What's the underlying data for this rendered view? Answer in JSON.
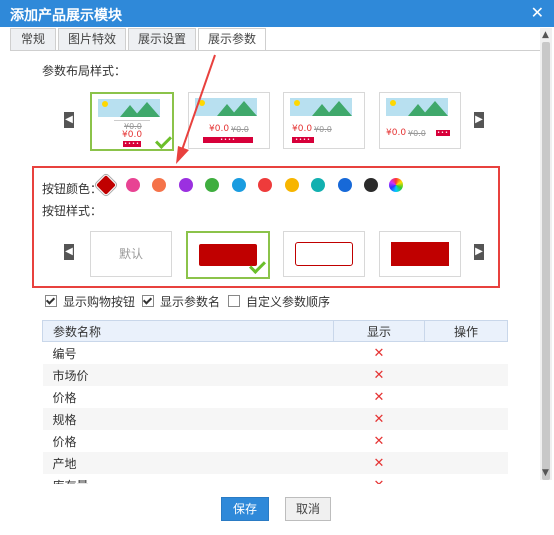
{
  "dialog": {
    "title": "添加产品展示模块",
    "close_glyph": "✕"
  },
  "tabs": [
    {
      "label": "常规"
    },
    {
      "label": "图片特效"
    },
    {
      "label": "展示设置"
    },
    {
      "label": "展示参数"
    }
  ],
  "layout_section": {
    "label": "参数布局样式：",
    "cards": [
      {
        "price": "¥0.0",
        "old": "¥0.0",
        "bar": "••••"
      },
      {
        "price": "¥0.0",
        "old": "¥0.0",
        "bar": "••••"
      },
      {
        "price": "¥0.0",
        "old": "¥0.0",
        "bar": "••••"
      },
      {
        "price": "¥0.0",
        "old": "¥0.0",
        "bar": "•••"
      }
    ]
  },
  "color_section": {
    "label": "按钮颜色：",
    "colors": [
      "#c00000",
      "#e84393",
      "#f5734a",
      "#9b30e0",
      "#3fae3f",
      "#1a9ce0",
      "#ee3b3b",
      "#f7b500",
      "#12b0b0",
      "#1769d8",
      "#2b2b2b"
    ]
  },
  "style_section": {
    "label": "按钮样式：",
    "default_label": "默认"
  },
  "checkboxes": [
    {
      "label": "显示购物按钮",
      "checked": true
    },
    {
      "label": "显示参数名",
      "checked": true
    },
    {
      "label": "自定义参数顺序",
      "checked": false
    }
  ],
  "table": {
    "headers": [
      "参数名称",
      "显示",
      "操作"
    ],
    "rows": [
      {
        "name": "编号",
        "show": "✕"
      },
      {
        "name": "市场价",
        "show": "✕"
      },
      {
        "name": "价格",
        "show": "✕"
      },
      {
        "name": "规格",
        "show": "✕"
      },
      {
        "name": "价格",
        "show": "✕"
      },
      {
        "name": "产地",
        "show": "✕"
      },
      {
        "name": "库存量",
        "show": "✕"
      }
    ]
  },
  "footer": {
    "save_label": "保存",
    "cancel_label": "取消"
  },
  "icons": {
    "left": "◀",
    "right": "▶",
    "up": "▲",
    "down": "▼"
  },
  "colors": {
    "accent": "#2f89d9",
    "highlight": "#e8413e",
    "selected": "#8bc34a"
  }
}
